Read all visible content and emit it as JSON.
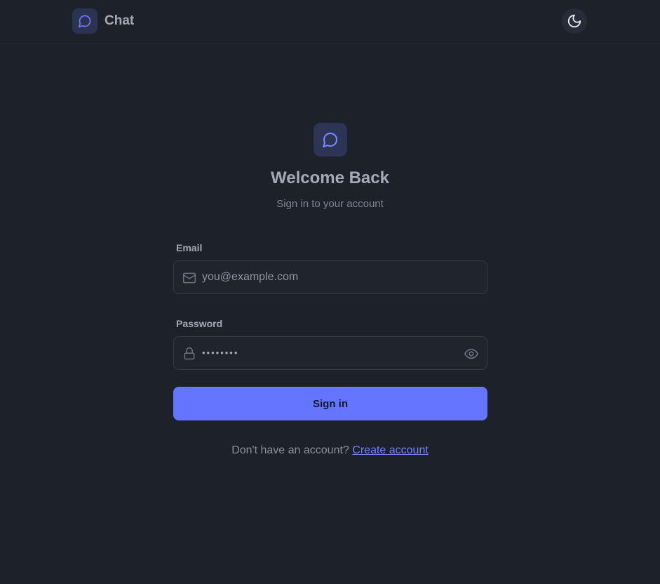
{
  "header": {
    "app_name": "Chat",
    "logo_icon": "chat-bubble-icon",
    "theme_toggle_icon": "moon-icon"
  },
  "main": {
    "hero_icon": "chat-bubble-icon",
    "title": "Welcome Back",
    "subtitle": "Sign in to your account",
    "email": {
      "label": "Email",
      "placeholder": "you@example.com",
      "value": "",
      "icon": "mail-icon"
    },
    "password": {
      "label": "Password",
      "value": "••••••••",
      "icon": "lock-icon",
      "toggle_icon": "eye-icon"
    },
    "submit_label": "Sign in",
    "footer_prompt": "Don't have an account?",
    "footer_link": "Create account"
  },
  "colors": {
    "background": "#1d2129",
    "accent": "#6675ff",
    "link": "#7580ff"
  }
}
